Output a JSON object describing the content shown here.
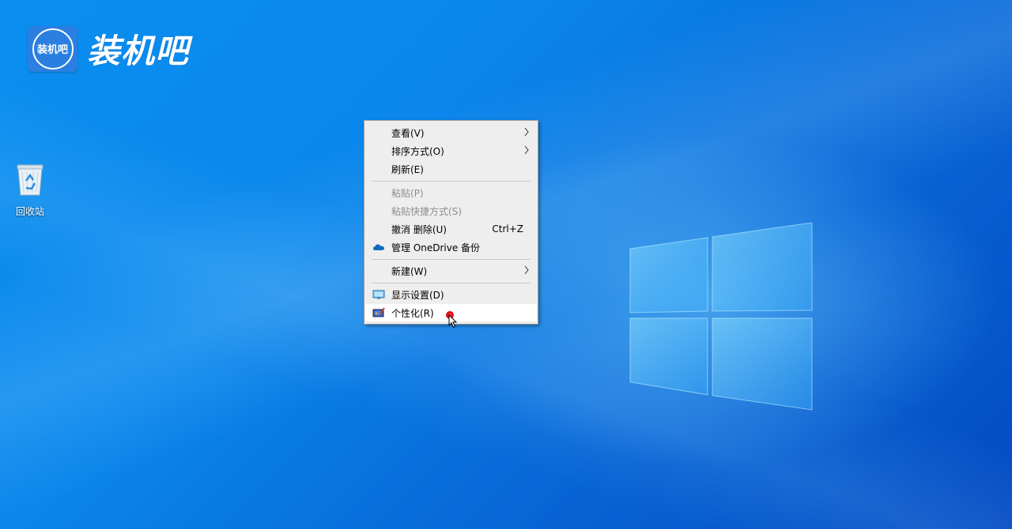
{
  "watermark": {
    "badge_text": "装机吧",
    "brand_text": "装机吧"
  },
  "desktop_icons": [
    {
      "label": "回收站",
      "icon": "recycle-bin-icon"
    }
  ],
  "context_menu": {
    "items": [
      {
        "label": "查看(V)",
        "submenu": true
      },
      {
        "label": "排序方式(O)",
        "submenu": true
      },
      {
        "label": "刷新(E)"
      },
      {
        "label": "粘贴(P)",
        "disabled": true
      },
      {
        "label": "粘贴快捷方式(S)",
        "disabled": true
      },
      {
        "label": "撤消 删除(U)",
        "shortcut": "Ctrl+Z"
      },
      {
        "label": "管理 OneDrive 备份",
        "icon": "onedrive-cloud-icon"
      },
      {
        "label": "新建(W)",
        "submenu": true
      },
      {
        "label": "显示设置(D)",
        "icon": "display-settings-icon"
      },
      {
        "label": "个性化(R)",
        "icon": "personalize-icon",
        "highlighted": true
      }
    ]
  },
  "colors": {
    "desktop_blue": "#0a86ec",
    "menu_bg": "#eeeeee",
    "menu_hover": "#ffffff",
    "disabled_text": "#8d8d8d",
    "cursor_highlight": "#e00000"
  }
}
